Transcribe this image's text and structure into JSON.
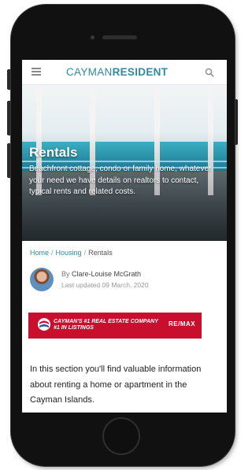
{
  "header": {
    "logo_light": "CAYMAN",
    "logo_bold": "RESIDENT"
  },
  "hero": {
    "title": "Rentals",
    "description": "Beachfront cottage, condo or family home, whatever your need we have details on realtors to contact, typical rents and related costs."
  },
  "breadcrumb": {
    "items": [
      "Home",
      "Housing",
      "Rentals"
    ],
    "separator": "/"
  },
  "author": {
    "prefix": "By",
    "name": "Clare-Louise McGrath",
    "updated": "Last updated 09 March, 2020"
  },
  "ad": {
    "text_line1": "CAYMAN'S #1 REAL ESTATE COMPANY",
    "text_line2": "#1 IN LISTINGS",
    "brand": "RE/MAX",
    "colors": {
      "background": "#c8102e"
    }
  },
  "content": {
    "intro": "In this section you'll find valuable information about renting a home or apartment in the Cayman Islands."
  },
  "icons": {
    "menu": "hamburger-menu-icon",
    "search": "search-icon"
  },
  "colors": {
    "accent": "#2f8aa0",
    "text": "#222222"
  }
}
